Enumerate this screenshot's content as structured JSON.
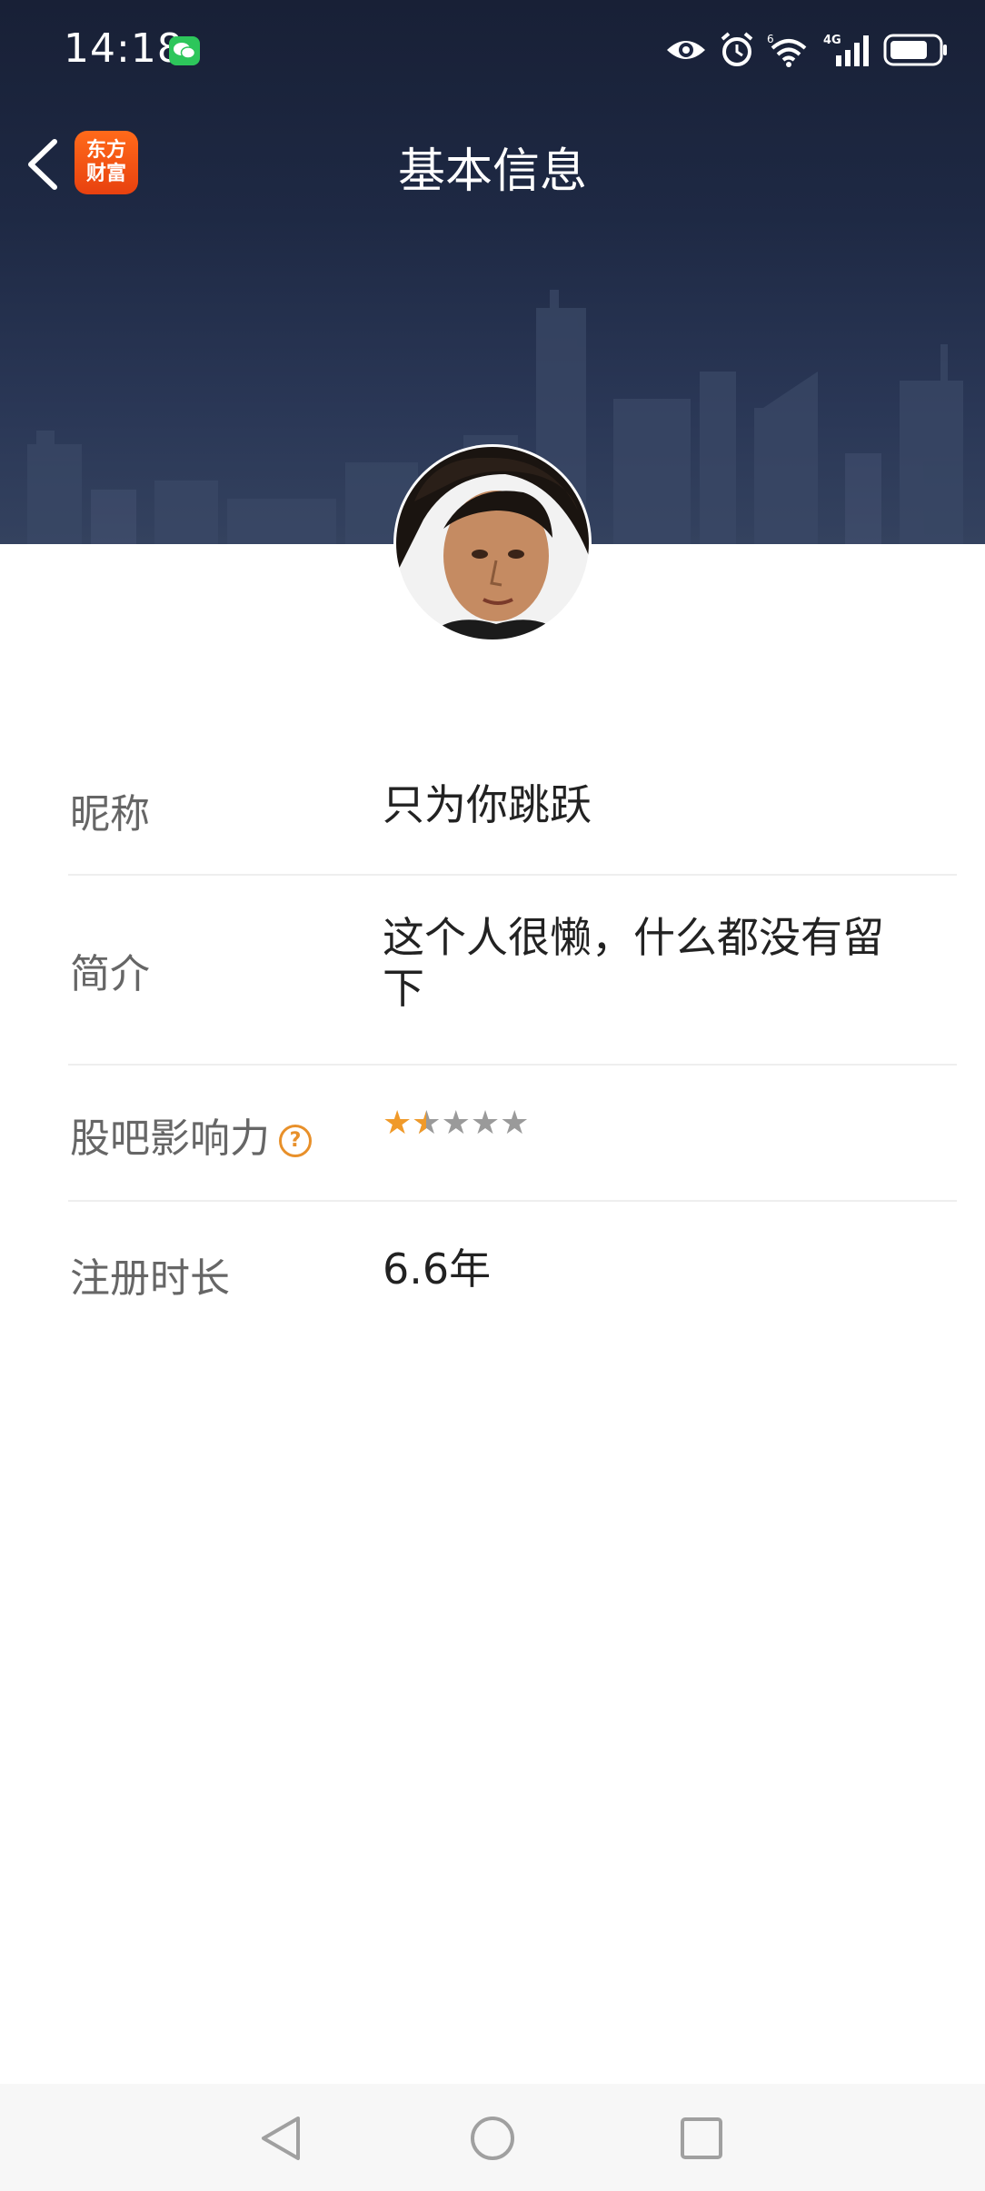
{
  "status_bar": {
    "time": "14:18",
    "icons": [
      "wechat-notification-icon",
      "eye-icon",
      "alarm-icon",
      "wifi-icon",
      "4g-signal-icon",
      "battery-icon"
    ]
  },
  "nav": {
    "title": "基本信息",
    "logo_line1": "东方",
    "logo_line2": "财富"
  },
  "profile": {
    "rows": [
      {
        "label": "昵称",
        "value": "只为你跳跃"
      },
      {
        "label": "简介",
        "value": "这个人很懒，什么都没有留下"
      },
      {
        "label": "股吧影响力",
        "help": "?",
        "rating": 1.5,
        "rating_max": 5
      },
      {
        "label": "注册时长",
        "value": "6.6年"
      }
    ]
  },
  "colors": {
    "accent": "#f09a2a",
    "header_bg": "#1e2944",
    "logo": "#ff5a14"
  }
}
